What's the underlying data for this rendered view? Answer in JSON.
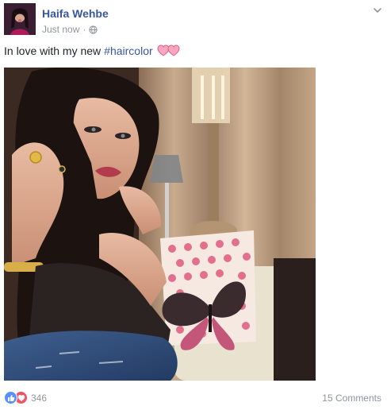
{
  "post": {
    "author_name": "Haifa Wehbe",
    "timestamp": "Just now",
    "separator": "·",
    "privacy_icon": "globe-icon",
    "menu_icon": "chevron-down-icon",
    "text": "In love with my new",
    "hashtag": "#haircolor",
    "emoji": "two-hearts-icon",
    "photo_subject": "selfie-photo",
    "reaction_icons": [
      "like-icon",
      "love-icon"
    ],
    "reaction_count": "346",
    "comment_count": "15 Comments"
  },
  "colors": {
    "author_link": "#365899",
    "meta_text": "#90949c",
    "like_blue": "#5890ff",
    "love_red": "#f25268",
    "body_text": "#1d2129"
  }
}
